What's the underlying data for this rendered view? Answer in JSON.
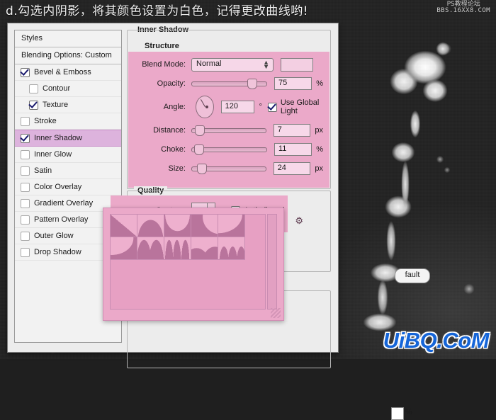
{
  "title": "d.勾选内阴影，将其颜色设置为白色，记得更改曲线哟!",
  "watermark_top": {
    "line1": "PS教程论坛",
    "line2": "BBS.16XX8.COM"
  },
  "watermark_bottom": "UiBQ.CoM",
  "overlay_letter": "d",
  "colors": {
    "pink_wash": "#eba9c9",
    "selected_row": "#ddb3dd",
    "dialog_bg": "#ececec",
    "watermark_blue": "#1565d8",
    "letter_pink": "#f49a9a"
  },
  "styles_panel": {
    "header": "Styles",
    "blending_options": "Blending Options: Custom",
    "items": [
      {
        "label": "Bevel & Emboss",
        "checked": true,
        "sub": false,
        "selected": false
      },
      {
        "label": "Contour",
        "checked": false,
        "sub": true,
        "selected": false
      },
      {
        "label": "Texture",
        "checked": true,
        "sub": true,
        "selected": false
      },
      {
        "label": "Stroke",
        "checked": false,
        "sub": false,
        "selected": false
      },
      {
        "label": "Inner Shadow",
        "checked": true,
        "sub": false,
        "selected": true
      },
      {
        "label": "Inner Glow",
        "checked": false,
        "sub": false,
        "selected": false
      },
      {
        "label": "Satin",
        "checked": false,
        "sub": false,
        "selected": false
      },
      {
        "label": "Color Overlay",
        "checked": false,
        "sub": false,
        "selected": false
      },
      {
        "label": "Gradient Overlay",
        "checked": false,
        "sub": false,
        "selected": false
      },
      {
        "label": "Pattern Overlay",
        "checked": false,
        "sub": false,
        "selected": false
      },
      {
        "label": "Outer Glow",
        "checked": false,
        "sub": false,
        "selected": false
      },
      {
        "label": "Drop Shadow",
        "checked": false,
        "sub": false,
        "selected": false
      }
    ]
  },
  "inner_shadow": {
    "group_title": "Inner Shadow",
    "structure": {
      "title": "Structure",
      "blend_mode_label": "Blend Mode:",
      "blend_mode_value": "Normal",
      "opacity_label": "Opacity:",
      "opacity_value": "75",
      "opacity_unit": "%",
      "opacity_pct": 75,
      "angle_label": "Angle:",
      "angle_value": "120",
      "angle_unit": "°",
      "use_global_light": "Use Global Light",
      "use_global_light_checked": true,
      "distance_label": "Distance:",
      "distance_value": "7",
      "distance_unit": "px",
      "distance_pct": 6,
      "choke_label": "Choke:",
      "choke_value": "11",
      "choke_unit": "%",
      "choke_pct": 5,
      "size_label": "Size:",
      "size_value": "24",
      "size_unit": "px",
      "size_pct": 9
    },
    "quality": {
      "title": "Quality",
      "contour_label": "Contour:",
      "anti_aliased_label": "Anti-aliased",
      "anti_aliased_checked": false,
      "noise_unit": "%"
    }
  },
  "buttons": {
    "make_default": "fault"
  },
  "contour_picker": {
    "cells": [
      "linear",
      "cone",
      "cone-inverted",
      "gaussian",
      "half-round",
      "ring",
      "ring-double",
      "steps",
      "rolling-slope",
      "rounded-steps"
    ]
  }
}
